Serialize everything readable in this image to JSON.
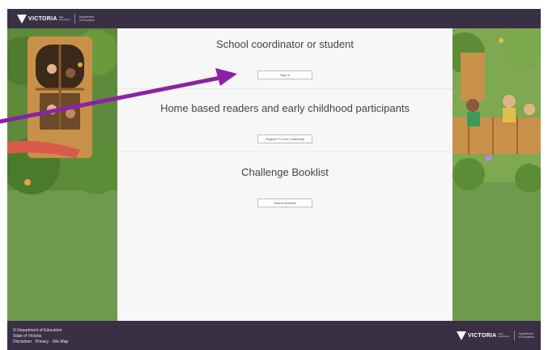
{
  "header": {
    "logo_word": "VICTORIA",
    "logo_sub": "State Government",
    "dept_line1": "Department",
    "dept_line2": "of Education"
  },
  "sections": [
    {
      "title": "School coordinator or student",
      "button": "Sign in"
    },
    {
      "title": "Home based readers and early childhood participants",
      "button": "Register For the Challenge"
    },
    {
      "title": "Challenge Booklist",
      "button": "Search Booklist"
    }
  ],
  "footer": {
    "copyright": "© Department of Education",
    "state": "State of Victoria",
    "links": [
      "Disclaimer",
      "Privacy",
      "Site Map"
    ],
    "logo_word": "VICTORIA",
    "logo_sub": "State Government",
    "dept_line1": "Department",
    "dept_line2": "of Education"
  },
  "colors": {
    "bar": "#3a3046",
    "panel": "#f7f7f7",
    "arrow": "#8b22a6",
    "grass": "#6f9a4e"
  }
}
